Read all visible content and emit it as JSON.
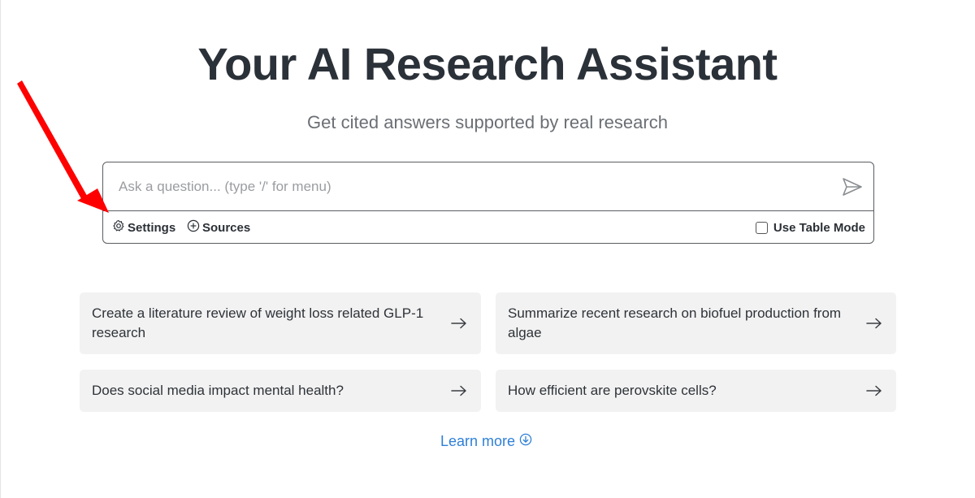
{
  "hero": {
    "title": "Your AI Research Assistant",
    "subtitle": "Get cited answers supported by real research"
  },
  "search": {
    "placeholder": "Ask a question... (type '/' for menu)",
    "value": "",
    "send_icon": "send-icon"
  },
  "toolbar": {
    "settings_label": "Settings",
    "settings_icon": "gear-icon",
    "sources_label": "Sources",
    "sources_icon": "plus-circle-icon",
    "table_mode_label": "Use Table Mode",
    "table_mode_checked": false
  },
  "suggestions": [
    {
      "text": "Create a literature review of weight loss related GLP-1 research",
      "icon": "arrow-right-icon"
    },
    {
      "text": "Summarize recent research on biofuel production from algae",
      "icon": "arrow-right-icon"
    },
    {
      "text": "Does social media impact mental health?",
      "icon": "arrow-right-icon"
    },
    {
      "text": "How efficient are perovskite cells?",
      "icon": "arrow-right-icon"
    }
  ],
  "learn_more": {
    "label": "Learn more",
    "icon": "arrow-down-circle-icon"
  },
  "colors": {
    "title": "#2b3138",
    "link": "#2f7fd6",
    "card_background": "#f2f2f2",
    "annotation_arrow": "#ff0000"
  }
}
